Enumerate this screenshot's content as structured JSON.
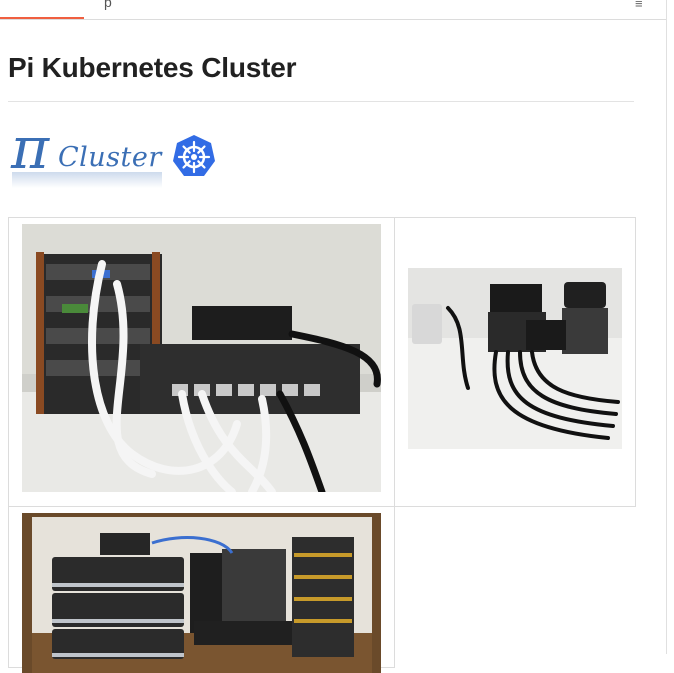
{
  "header": {
    "tab_fragment": "p",
    "toc_icon": "list-icon"
  },
  "page": {
    "title": "Pi Kubernetes Cluster"
  },
  "logo": {
    "pi_glyph": "π",
    "word": "Cluster",
    "badge_icon": "kubernetes-helm-icon"
  },
  "colors": {
    "accent": "#f05f40",
    "logo_blue": "#3b6fb5",
    "kubernetes_blue": "#326ce5"
  },
  "photos": [
    {
      "name": "pi-stack-with-switch-photo"
    },
    {
      "name": "pi-cluster-with-power-photo"
    },
    {
      "name": "mini-pc-and-pi-cluster-photo"
    }
  ]
}
